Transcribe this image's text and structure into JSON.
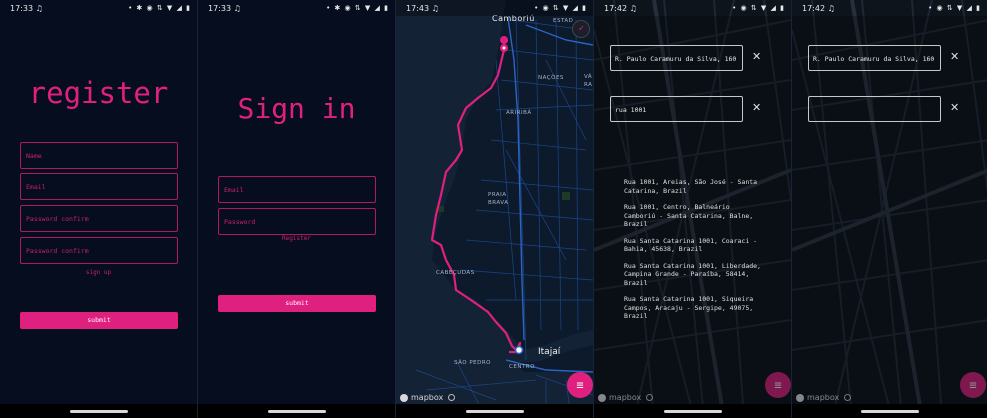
{
  "screens": {
    "register": {
      "status_time": "17:33",
      "title": "register",
      "fields": [
        "Name",
        "Email",
        "Password confirm",
        "Password confirm"
      ],
      "link": "sign up",
      "submit": "submit"
    },
    "signin": {
      "status_time": "17:33",
      "title": "Sign in",
      "fields": [
        "Email",
        "Password"
      ],
      "link": "Register",
      "submit": "submit"
    },
    "map": {
      "status_time": "17:43",
      "labels": {
        "camboriu": "Camboriú",
        "estado": "ESTAD",
        "nacoes": "NAÇÕES",
        "va": "VÁ",
        "ra": "RA",
        "aririba": "ARIRIBÁ",
        "praia": "PRAIA",
        "brava": "BRAVA",
        "cabecudas": "CABEÇUDAS",
        "itajai": "Itajaí",
        "sao_pedro": "SÃO PEDRO",
        "centro": "CENTRO",
        "mapbox": "mapbox"
      }
    },
    "search": {
      "status_time": "17:42",
      "origin_value": "R. Paulo Caramuru da Silva, 160",
      "destination_value": "rua 1001",
      "suggestions": [
        "Rua 1001, Areias, São José - Santa Catarina, Brazil",
        "Rua 1001, Centro, Balneário Camboriú - Santa Catarina, Balne, Brazil",
        "Rua Santa Catarina 1001, Coaraci - Bahia, 45638, Brazil",
        "Rua Santa Catarina 1001, Liberdade, Campina Grande - Paraíba, 58414, Brazil",
        "Rua Santa Catarina 1001, Siqueira Campos, Aracaju - Sergipe, 49075, Brazil"
      ],
      "mapbox": "mapbox"
    },
    "search_empty": {
      "status_time": "17:42",
      "origin_value": "R. Paulo Caramuru da Silva, 160",
      "destination_value": "",
      "mapbox": "mapbox"
    }
  },
  "icons": {
    "music": "music-note-icon",
    "menu": "menu-icon",
    "compass": "compass-icon",
    "close": "close-icon"
  },
  "colors": {
    "accent": "#e0207f",
    "background": "#060d1e",
    "map_road": "#1f4f9a"
  }
}
